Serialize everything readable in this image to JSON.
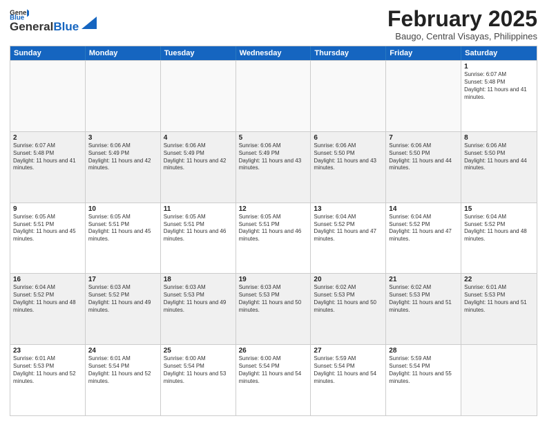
{
  "header": {
    "logo_general": "General",
    "logo_blue": "Blue",
    "month": "February 2025",
    "location": "Baugo, Central Visayas, Philippines"
  },
  "weekdays": [
    "Sunday",
    "Monday",
    "Tuesday",
    "Wednesday",
    "Thursday",
    "Friday",
    "Saturday"
  ],
  "rows": [
    [
      {
        "day": "",
        "text": ""
      },
      {
        "day": "",
        "text": ""
      },
      {
        "day": "",
        "text": ""
      },
      {
        "day": "",
        "text": ""
      },
      {
        "day": "",
        "text": ""
      },
      {
        "day": "",
        "text": ""
      },
      {
        "day": "1",
        "text": "Sunrise: 6:07 AM\nSunset: 5:48 PM\nDaylight: 11 hours and 41 minutes."
      }
    ],
    [
      {
        "day": "2",
        "text": "Sunrise: 6:07 AM\nSunset: 5:48 PM\nDaylight: 11 hours and 41 minutes."
      },
      {
        "day": "3",
        "text": "Sunrise: 6:06 AM\nSunset: 5:49 PM\nDaylight: 11 hours and 42 minutes."
      },
      {
        "day": "4",
        "text": "Sunrise: 6:06 AM\nSunset: 5:49 PM\nDaylight: 11 hours and 42 minutes."
      },
      {
        "day": "5",
        "text": "Sunrise: 6:06 AM\nSunset: 5:49 PM\nDaylight: 11 hours and 43 minutes."
      },
      {
        "day": "6",
        "text": "Sunrise: 6:06 AM\nSunset: 5:50 PM\nDaylight: 11 hours and 43 minutes."
      },
      {
        "day": "7",
        "text": "Sunrise: 6:06 AM\nSunset: 5:50 PM\nDaylight: 11 hours and 44 minutes."
      },
      {
        "day": "8",
        "text": "Sunrise: 6:06 AM\nSunset: 5:50 PM\nDaylight: 11 hours and 44 minutes."
      }
    ],
    [
      {
        "day": "9",
        "text": "Sunrise: 6:05 AM\nSunset: 5:51 PM\nDaylight: 11 hours and 45 minutes."
      },
      {
        "day": "10",
        "text": "Sunrise: 6:05 AM\nSunset: 5:51 PM\nDaylight: 11 hours and 45 minutes."
      },
      {
        "day": "11",
        "text": "Sunrise: 6:05 AM\nSunset: 5:51 PM\nDaylight: 11 hours and 46 minutes."
      },
      {
        "day": "12",
        "text": "Sunrise: 6:05 AM\nSunset: 5:51 PM\nDaylight: 11 hours and 46 minutes."
      },
      {
        "day": "13",
        "text": "Sunrise: 6:04 AM\nSunset: 5:52 PM\nDaylight: 11 hours and 47 minutes."
      },
      {
        "day": "14",
        "text": "Sunrise: 6:04 AM\nSunset: 5:52 PM\nDaylight: 11 hours and 47 minutes."
      },
      {
        "day": "15",
        "text": "Sunrise: 6:04 AM\nSunset: 5:52 PM\nDaylight: 11 hours and 48 minutes."
      }
    ],
    [
      {
        "day": "16",
        "text": "Sunrise: 6:04 AM\nSunset: 5:52 PM\nDaylight: 11 hours and 48 minutes."
      },
      {
        "day": "17",
        "text": "Sunrise: 6:03 AM\nSunset: 5:52 PM\nDaylight: 11 hours and 49 minutes."
      },
      {
        "day": "18",
        "text": "Sunrise: 6:03 AM\nSunset: 5:53 PM\nDaylight: 11 hours and 49 minutes."
      },
      {
        "day": "19",
        "text": "Sunrise: 6:03 AM\nSunset: 5:53 PM\nDaylight: 11 hours and 50 minutes."
      },
      {
        "day": "20",
        "text": "Sunrise: 6:02 AM\nSunset: 5:53 PM\nDaylight: 11 hours and 50 minutes."
      },
      {
        "day": "21",
        "text": "Sunrise: 6:02 AM\nSunset: 5:53 PM\nDaylight: 11 hours and 51 minutes."
      },
      {
        "day": "22",
        "text": "Sunrise: 6:01 AM\nSunset: 5:53 PM\nDaylight: 11 hours and 51 minutes."
      }
    ],
    [
      {
        "day": "23",
        "text": "Sunrise: 6:01 AM\nSunset: 5:53 PM\nDaylight: 11 hours and 52 minutes."
      },
      {
        "day": "24",
        "text": "Sunrise: 6:01 AM\nSunset: 5:54 PM\nDaylight: 11 hours and 52 minutes."
      },
      {
        "day": "25",
        "text": "Sunrise: 6:00 AM\nSunset: 5:54 PM\nDaylight: 11 hours and 53 minutes."
      },
      {
        "day": "26",
        "text": "Sunrise: 6:00 AM\nSunset: 5:54 PM\nDaylight: 11 hours and 54 minutes."
      },
      {
        "day": "27",
        "text": "Sunrise: 5:59 AM\nSunset: 5:54 PM\nDaylight: 11 hours and 54 minutes."
      },
      {
        "day": "28",
        "text": "Sunrise: 5:59 AM\nSunset: 5:54 PM\nDaylight: 11 hours and 55 minutes."
      },
      {
        "day": "",
        "text": ""
      }
    ]
  ]
}
